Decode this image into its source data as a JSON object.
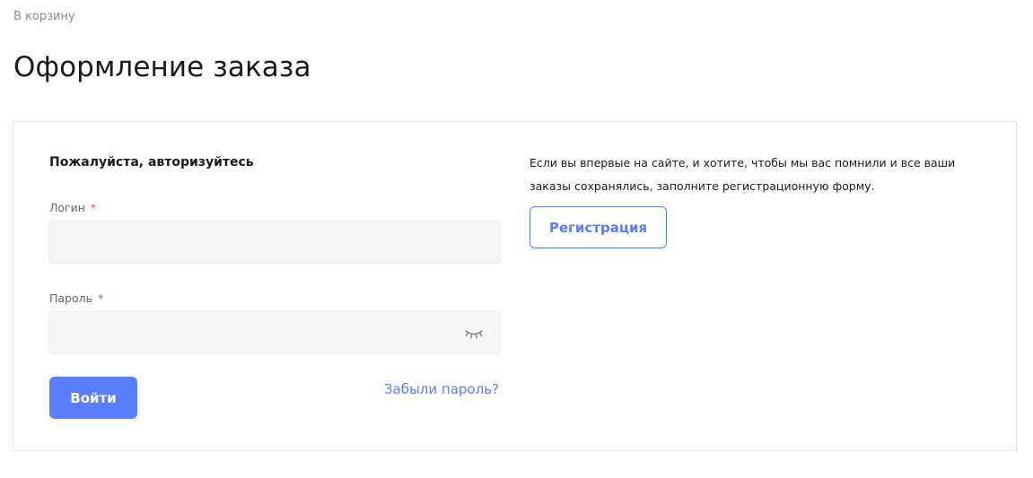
{
  "breadcrumb": {
    "back_to_cart": "В корзину"
  },
  "page": {
    "title": "Оформление заказа"
  },
  "login": {
    "heading": "Пожалуйста, авторизуйтесь",
    "login_label": "Логин",
    "password_label": "Пароль",
    "required_mark": "*",
    "login_value": "",
    "password_value": "",
    "submit_label": "Войти",
    "forgot_label": "Забыли пароль?"
  },
  "register": {
    "text": "Если вы впервые на сайте, и хотите, чтобы мы вас помнили и все ваши заказы сохранялись, заполните регистрационную форму.",
    "button_label": "Регистрация"
  },
  "icons": {
    "password_toggle": "eye-closed-icon"
  },
  "colors": {
    "accent": "#5a7dff",
    "required": "#d9534f",
    "muted_text": "#8c8c8c",
    "input_bg": "#f6f6f6"
  }
}
